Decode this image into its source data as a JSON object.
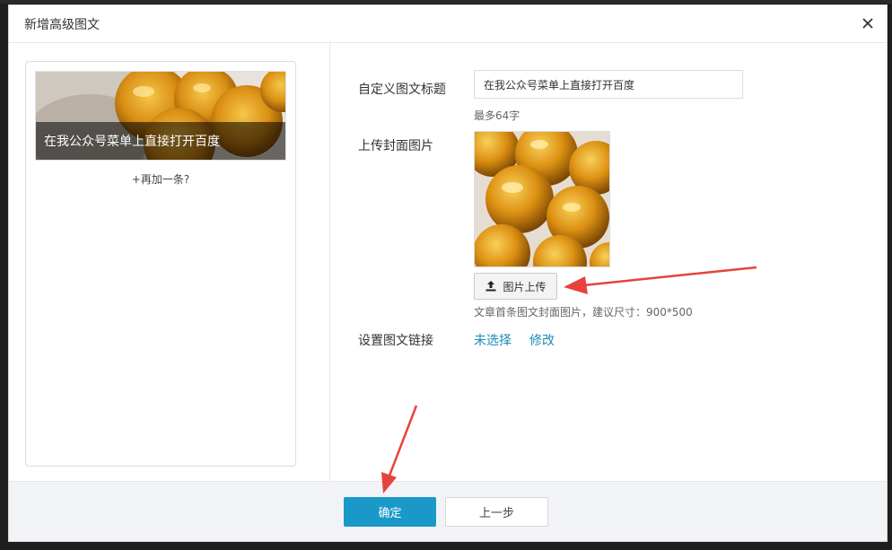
{
  "dialog": {
    "title": "新增高级图文",
    "close_icon": "close-icon"
  },
  "preview": {
    "caption": "在我公众号菜单上直接打开百度",
    "add_more": "+再加一条?"
  },
  "form": {
    "title_label": "自定义图文标题",
    "title_value": "在我公众号菜单上直接打开百度",
    "title_hint": "最多64字",
    "cover_label": "上传封面图片",
    "upload_button": "图片上传",
    "upload_icon": "upload-icon",
    "cover_hint": "文章首条图文封面图片，建议尺寸：900*500",
    "link_label": "设置图文链接",
    "link_status": "未选择",
    "link_edit": "修改"
  },
  "footer": {
    "confirm": "确定",
    "previous": "上一步"
  },
  "colors": {
    "accent": "#1a99c9",
    "link": "#1a8bb8",
    "annotation_arrow": "#e8423c"
  }
}
